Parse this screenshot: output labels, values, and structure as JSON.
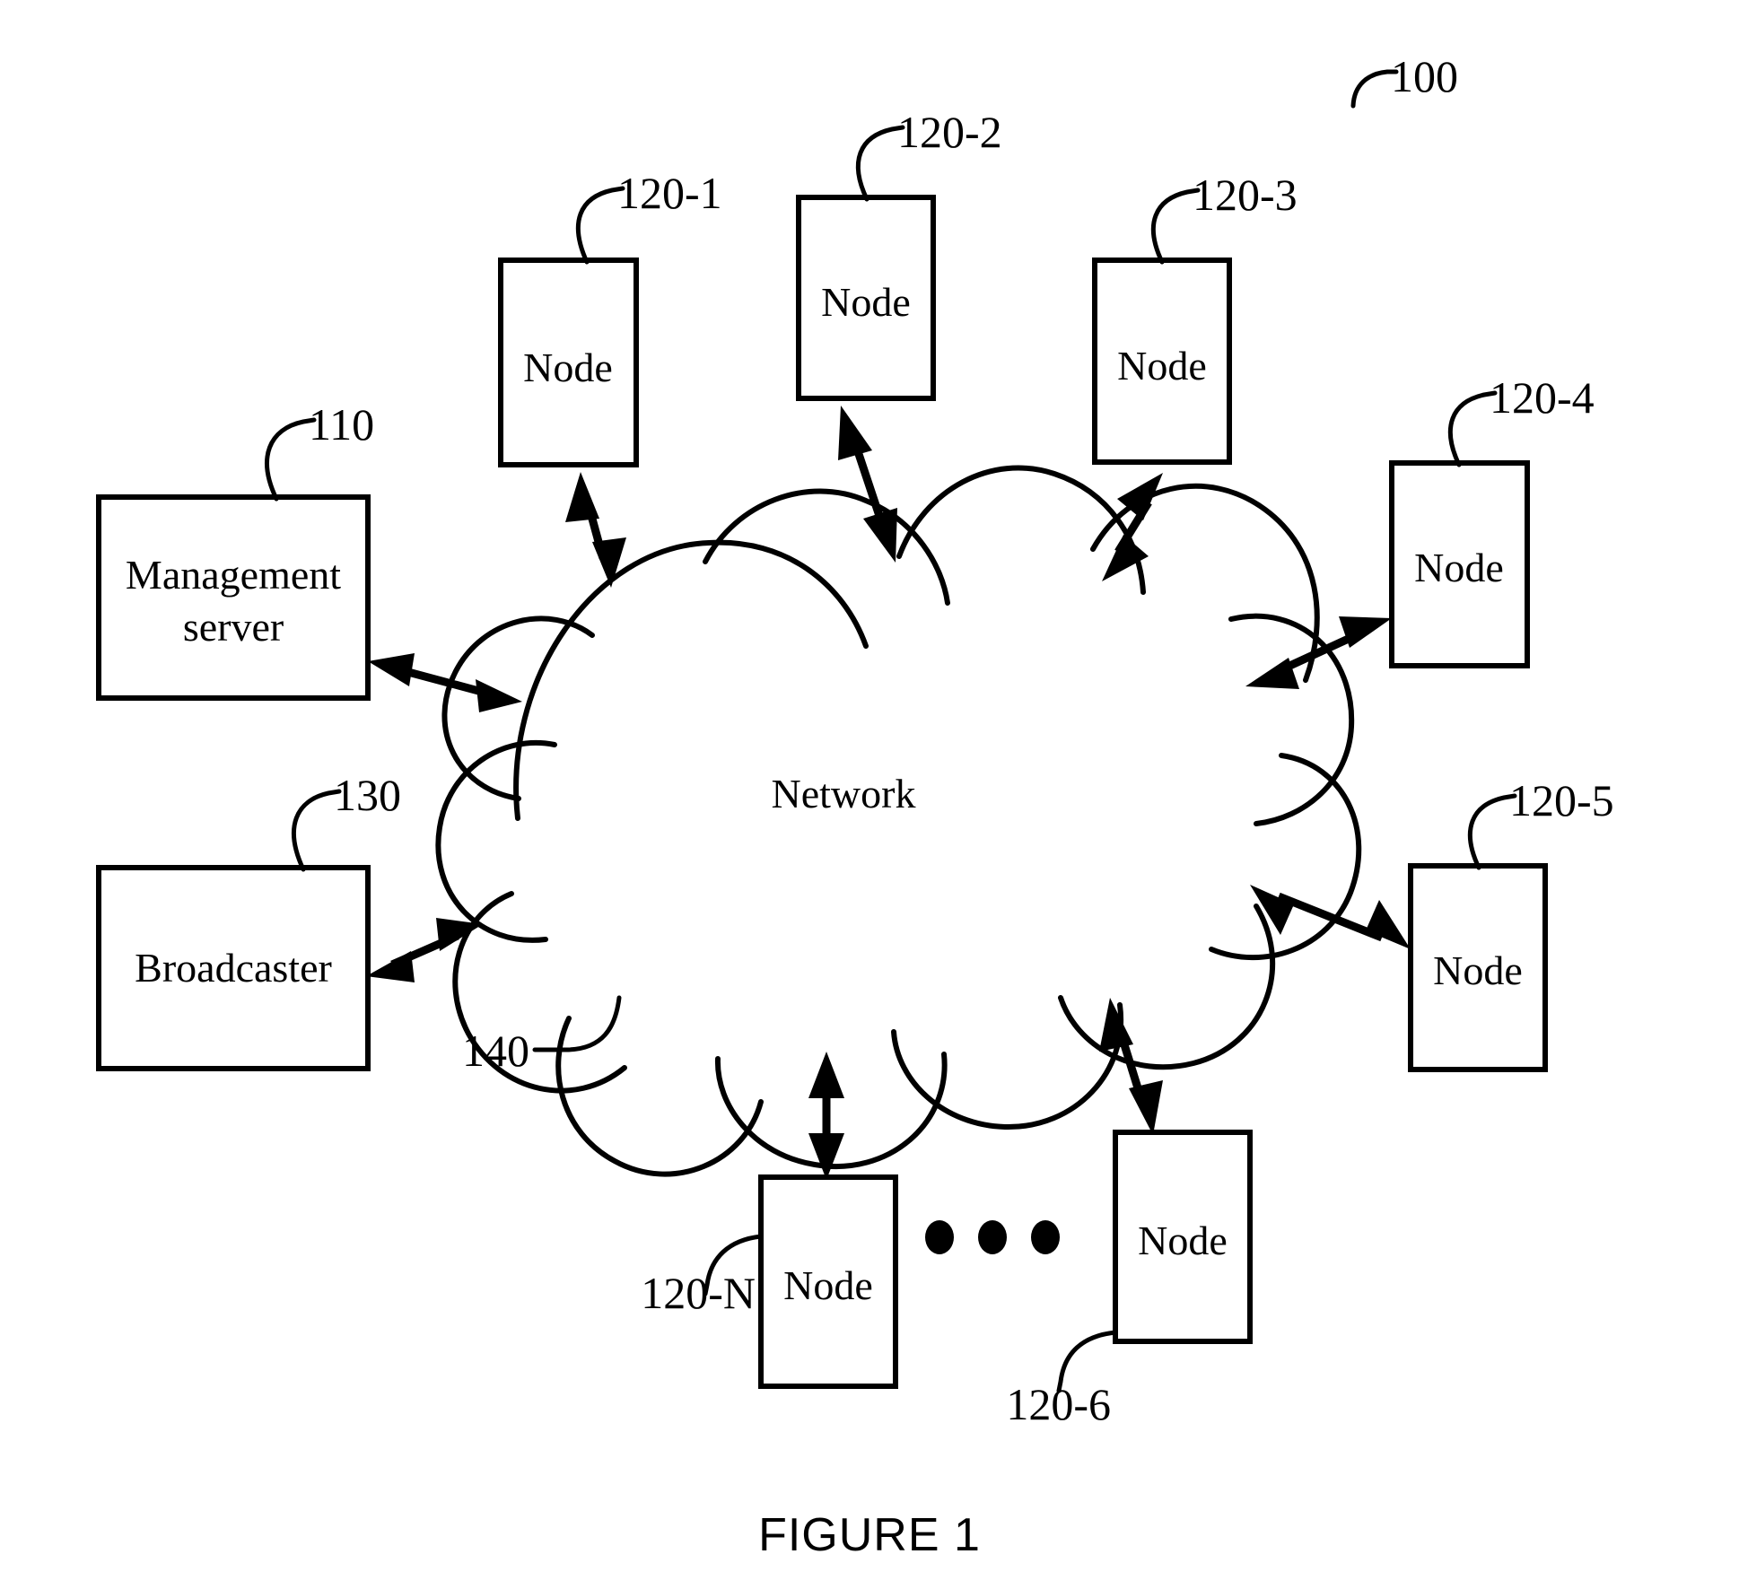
{
  "figure": {
    "caption": "FIGURE 1",
    "system_ref": "100"
  },
  "cloud": {
    "label": "Network",
    "ref": "140"
  },
  "boxes": [
    {
      "id": "management-server",
      "ref": "110",
      "line1": "Management",
      "line2": "server"
    },
    {
      "id": "broadcaster",
      "ref": "130",
      "line1": "Broadcaster",
      "line2": ""
    },
    {
      "id": "node-120-1",
      "ref": "120-1",
      "line1": "Node",
      "line2": ""
    },
    {
      "id": "node-120-2",
      "ref": "120-2",
      "line1": "Node",
      "line2": ""
    },
    {
      "id": "node-120-3",
      "ref": "120-3",
      "line1": "Node",
      "line2": ""
    },
    {
      "id": "node-120-4",
      "ref": "120-4",
      "line1": "Node",
      "line2": ""
    },
    {
      "id": "node-120-5",
      "ref": "120-5",
      "line1": "Node",
      "line2": ""
    },
    {
      "id": "node-120-6",
      "ref": "120-6",
      "line1": "Node",
      "line2": ""
    },
    {
      "id": "node-120-N",
      "ref": "120-N",
      "line1": "Node",
      "line2": ""
    }
  ],
  "colors": {
    "ink": "#000000",
    "paper": "#ffffff"
  }
}
